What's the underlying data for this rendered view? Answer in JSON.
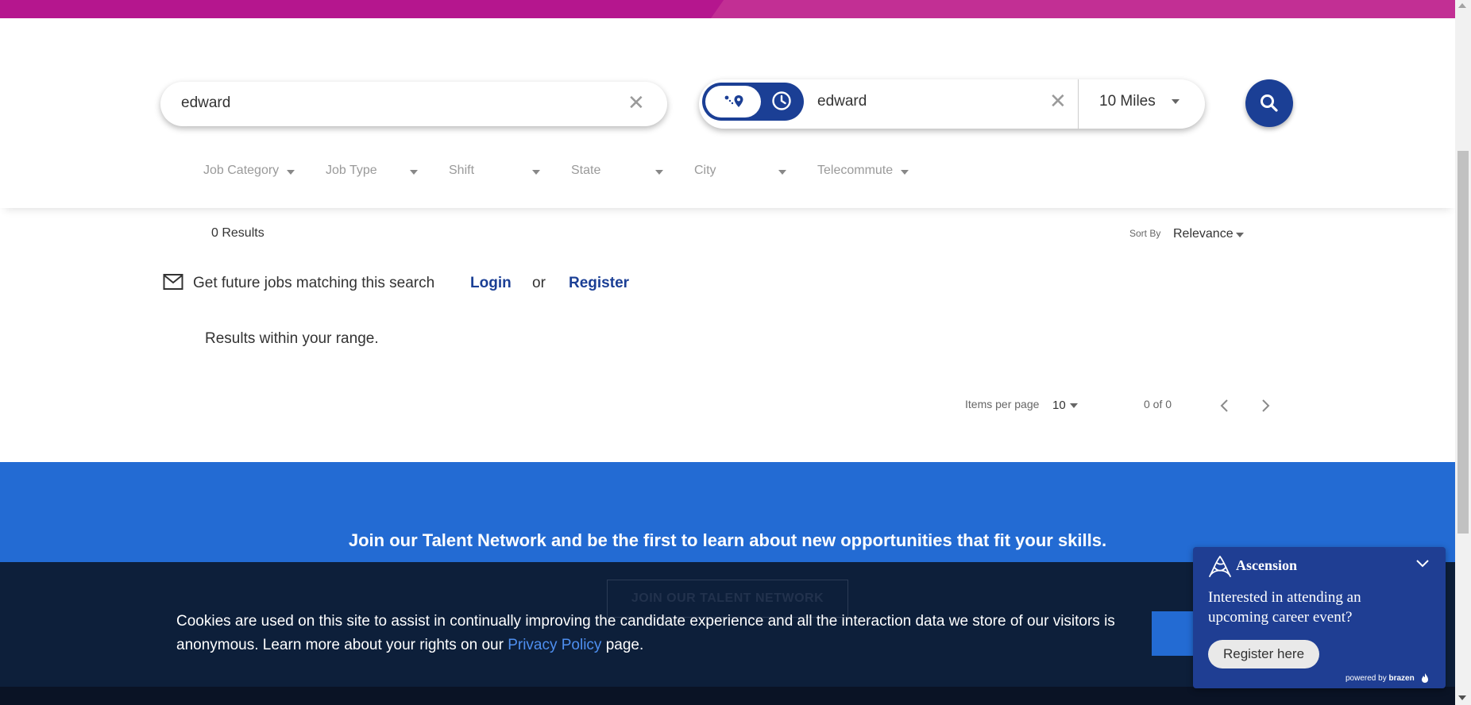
{
  "colors": {
    "brand_magenta": "#b5168e",
    "primary_blue": "#1b3f95",
    "talent_blue": "#236bd3",
    "cookie_bg": "#0d1f3a",
    "link_blue": "#4e8ff0"
  },
  "search": {
    "keyword_value": "edward",
    "location_value": "edward",
    "radius": "10 Miles",
    "icons": {
      "clear": "close-icon",
      "mode_location": "route-pin-icon",
      "mode_commute": "clock-icon",
      "submit": "search-icon"
    }
  },
  "filters": [
    "Job Category",
    "Job Type",
    "Shift",
    "State",
    "City",
    "Telecommute"
  ],
  "results": {
    "count_label": "0 Results",
    "sort_by_label": "Sort By",
    "sort_value": "Relevance",
    "alert_text": "Get future jobs matching this search",
    "login_label": "Login",
    "or_label": "or",
    "register_label": "Register",
    "range_message": "Results within your range.",
    "items_per_page_label": "Items per page",
    "items_per_page_value": "10",
    "page_range": "0 of 0"
  },
  "talent": {
    "headline": "Join our Talent Network and be the first to learn about new opportunities that fit your skills.",
    "button_label": "JOIN OUR TALENT NETWORK"
  },
  "cookie": {
    "text_before": "Cookies are used on this site to assist in continually improving the candidate experience and all the interaction data we store of our visitors is anonymous. Learn more about your rights on our ",
    "link_label": "Privacy Policy",
    "text_after": " page."
  },
  "widget": {
    "brand": "Ascension",
    "title": "Interested in attending an upcoming career event?",
    "button_label": "Register here",
    "powered_by": "powered by",
    "powered_brand": "brazen"
  }
}
